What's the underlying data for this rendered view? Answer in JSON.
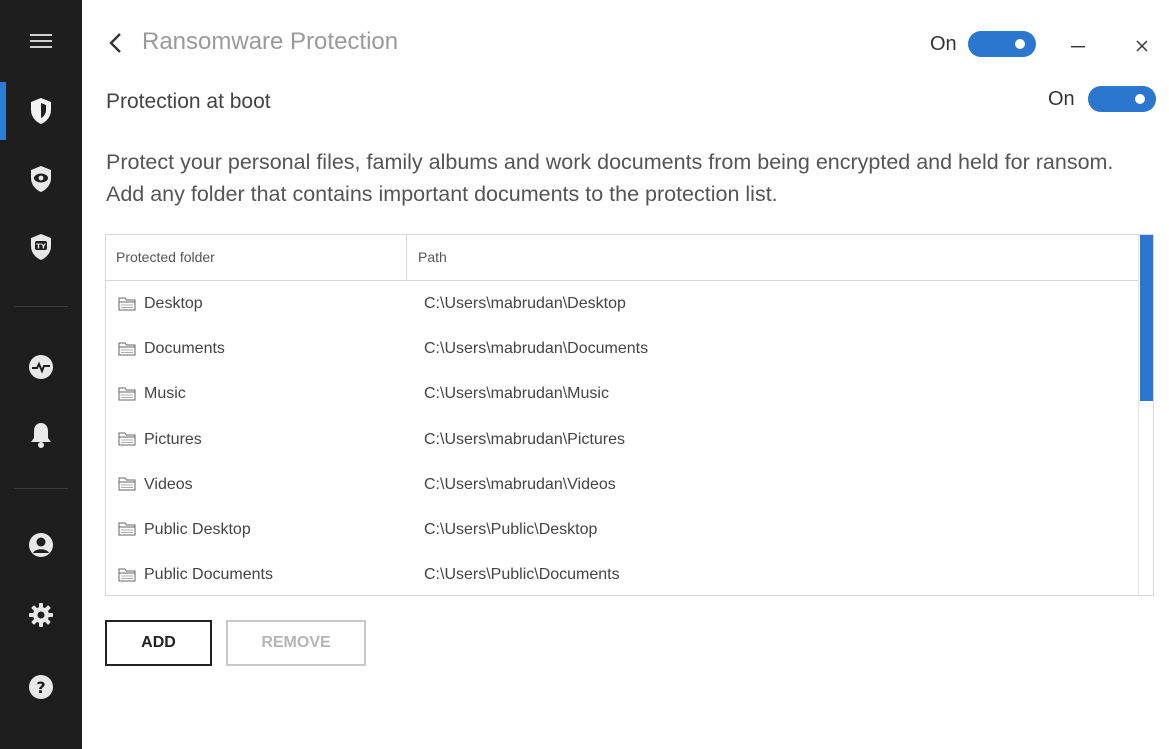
{
  "header": {
    "back_icon": "chevron-left-icon",
    "title": "Ransomware Protection",
    "toggle_label": "On",
    "toggle_on": true,
    "minimize_icon": "minimize-icon",
    "close_icon": "close-icon"
  },
  "boot": {
    "label": "Protection at boot",
    "toggle_label": "On",
    "toggle_on": true
  },
  "description": "Protect your personal files, family albums and work documents from being encrypted and held for ransom. Add any folder that contains important documents to the protection list.",
  "table": {
    "columns": [
      "Protected folder",
      "Path"
    ],
    "rows": [
      {
        "name": "Desktop",
        "path": "C:\\Users\\mabrudan\\Desktop"
      },
      {
        "name": "Documents",
        "path": "C:\\Users\\mabrudan\\Documents"
      },
      {
        "name": "Music",
        "path": "C:\\Users\\mabrudan\\Music"
      },
      {
        "name": "Pictures",
        "path": "C:\\Users\\mabrudan\\Pictures"
      },
      {
        "name": "Videos",
        "path": "C:\\Users\\mabrudan\\Videos"
      },
      {
        "name": "Public Desktop",
        "path": "C:\\Users\\Public\\Desktop"
      },
      {
        "name": "Public Documents",
        "path": "C:\\Users\\Public\\Documents"
      }
    ]
  },
  "buttons": {
    "add": "ADD",
    "remove": "REMOVE"
  },
  "sidebar": {
    "items": [
      {
        "icon": "menu-icon"
      },
      {
        "icon": "shield-icon",
        "active": true
      },
      {
        "icon": "eye-shield-icon"
      },
      {
        "icon": "ty-shield-icon"
      },
      {
        "icon": "activity-icon"
      },
      {
        "icon": "bell-icon"
      },
      {
        "icon": "account-icon"
      },
      {
        "icon": "gear-icon"
      },
      {
        "icon": "help-icon"
      }
    ]
  },
  "colors": {
    "accent": "#2b76cf",
    "sidebar": "#1e1e1e"
  }
}
